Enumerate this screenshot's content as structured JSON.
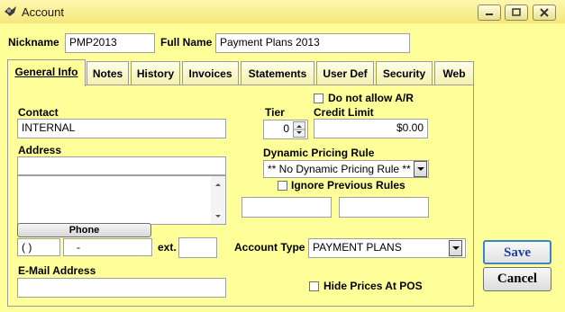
{
  "window": {
    "title": "Account"
  },
  "header": {
    "nickname_label": "Nickname",
    "nickname_value": "PMP2013",
    "fullname_label": "Full Name",
    "fullname_value": "Payment Plans 2013"
  },
  "tabs": [
    {
      "label": "General Info",
      "active": true
    },
    {
      "label": "Notes"
    },
    {
      "label": "History"
    },
    {
      "label": "Invoices"
    },
    {
      "label": "Statements"
    },
    {
      "label": "User Def"
    },
    {
      "label": "Security"
    },
    {
      "label": "Web"
    }
  ],
  "general": {
    "do_not_allow_ar_label": "Do not allow A/R",
    "contact_label": "Contact",
    "contact_value": "INTERNAL",
    "tier_label": "Tier",
    "tier_value": "0",
    "credit_limit_label": "Credit Limit",
    "credit_limit_value": "$0.00",
    "address_label": "Address",
    "address_line1": "",
    "dynamic_pricing_label": "Dynamic Pricing Rule",
    "dynamic_pricing_value": "** No Dynamic Pricing Rule **",
    "ignore_previous_label": "Ignore Previous Rules",
    "phone_button_label": "Phone",
    "phone_area": "(   )",
    "phone_number": "-",
    "ext_label": "ext.",
    "ext_value": "",
    "account_type_label": "Account Type",
    "account_type_value": "PAYMENT PLANS",
    "email_label": "E-Mail Address",
    "email_value": "",
    "hide_prices_label": "Hide Prices At POS"
  },
  "actions": {
    "save_label": "Save",
    "cancel_label": "Cancel"
  },
  "colors": {
    "background": "#ffff99",
    "save_text": "#1b3f9e"
  }
}
